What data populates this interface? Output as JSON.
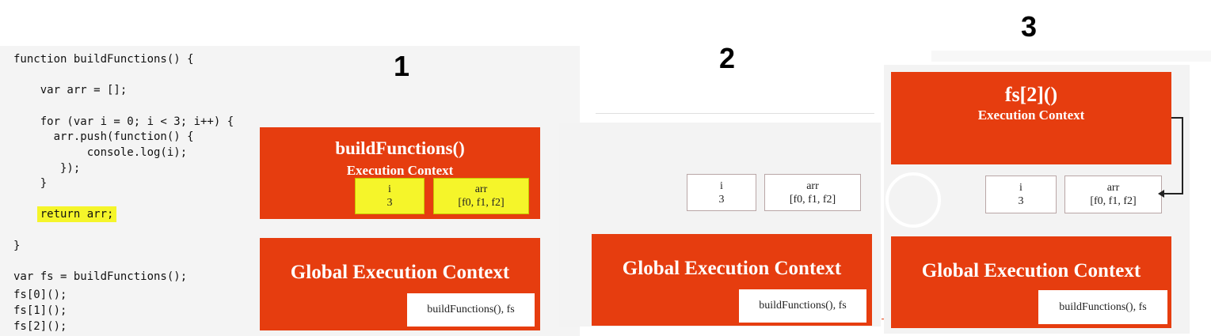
{
  "code": {
    "lines": [
      "function buildFunctions() {",
      "    var arr = [];",
      "    for (var i = 0; i < 3; i++) {",
      "      arr.push(function() {",
      "           console.log(i);",
      "       });",
      "    }",
      "    return arr;",
      "}",
      "var fs = buildFunctions();",
      "fs[0]();",
      "fs[1]();",
      "fs[2]();"
    ],
    "highlight_color": "#f5f52a"
  },
  "steps": {
    "one": "1",
    "two": "2",
    "three": "3"
  },
  "colors": {
    "context": "#e63d0f",
    "highlight": "#f5f52a",
    "slide_bg": "#f3f3f3"
  },
  "panel1": {
    "ctx_title": "buildFunctions()",
    "ctx_subtitle": "Execution Context",
    "var_i_name": "i",
    "var_i_value": "3",
    "var_arr_name": "arr",
    "var_arr_value": "[f0, f1, f2]",
    "gec_title": "Global Execution Context",
    "gec_vars": "buildFunctions(), fs"
  },
  "panel2": {
    "var_i_name": "i",
    "var_i_value": "3",
    "var_arr_name": "arr",
    "var_arr_value": "[f0, f1, f2]",
    "gec_title": "Global Execution Context",
    "gec_vars": "buildFunctions(), fs"
  },
  "panel3": {
    "ctx_title": "fs[2]()",
    "ctx_subtitle": "Execution Context",
    "var_i_name": "i",
    "var_i_value": "3",
    "var_arr_name": "arr",
    "var_arr_value": "[f0, f1, f2]",
    "gec_title": "Global Execution Context",
    "gec_vars": "buildFunctions(), fs"
  }
}
